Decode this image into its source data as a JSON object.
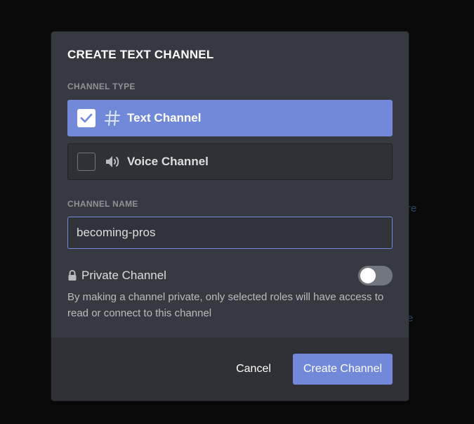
{
  "background": {
    "hint_1": "re",
    "hint_2": "e"
  },
  "modal": {
    "title": "Create Text Channel",
    "channel_type": {
      "label": "Channel Type",
      "options": [
        {
          "label": "Text Channel",
          "icon": "hash-icon",
          "selected": true
        },
        {
          "label": "Voice Channel",
          "icon": "speaker-icon",
          "selected": false
        }
      ]
    },
    "channel_name": {
      "label": "Channel Name",
      "value": "becoming-pros"
    },
    "private": {
      "label": "Private Channel",
      "icon": "lock-icon",
      "enabled": false,
      "description": "By making a channel private, only selected roles will have access to read or connect to this channel"
    },
    "footer": {
      "cancel_label": "Cancel",
      "create_label": "Create Channel"
    }
  },
  "colors": {
    "accent": "#7289da",
    "modal_bg": "#36393f",
    "footer_bg": "#2f3136",
    "backdrop": "#0a0a0b"
  }
}
